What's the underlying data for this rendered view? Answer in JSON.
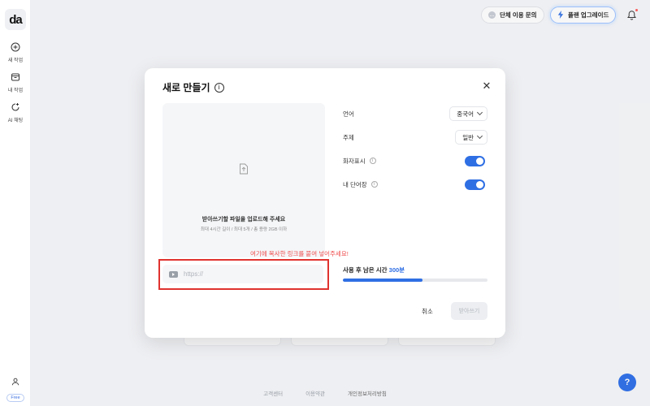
{
  "app": {
    "logo_text": "da"
  },
  "sidebar": {
    "items": [
      {
        "label": "새 작업",
        "icon": "plus-circle-icon"
      },
      {
        "label": "내 작업",
        "icon": "folder-icon"
      },
      {
        "label": "AI 채팅",
        "icon": "ai-chat-icon"
      }
    ],
    "plan_badge": "Free"
  },
  "topbar": {
    "group_inquiry": "단체 이용 문의",
    "upgrade": "플랜 업그레이드"
  },
  "footer": {
    "links": [
      "고객센터",
      "이용약관",
      "개인정보처리방침"
    ]
  },
  "help": {
    "label": "?"
  },
  "modal": {
    "title": "새로 만들기",
    "upload": {
      "main_text": "받아쓰기할 파일을 업로드해 주세요",
      "sub_text": "최대 4시간 길이 / 최대 5개 / 총 용량 2GB 이하"
    },
    "link_hint": "여기에 복사한 링크를 붙여 넣어주세요!",
    "link_placeholder": "https://",
    "options": {
      "language_label": "언어",
      "language_value": "중국어",
      "topic_label": "주제",
      "topic_value": "일반",
      "speaker_label": "화자표시",
      "speaker_on": true,
      "vocab_label": "내 단어장",
      "vocab_on": true
    },
    "remaining": {
      "label": "사용 후 남은 시간",
      "value": "300분",
      "progress_fraction": 0.55
    },
    "cancel_label": "취소",
    "submit_label": "받아쓰기"
  },
  "colors": {
    "accent": "#2f6fe4",
    "highlight": "#e0332f",
    "hint": "#ef4c4c"
  }
}
